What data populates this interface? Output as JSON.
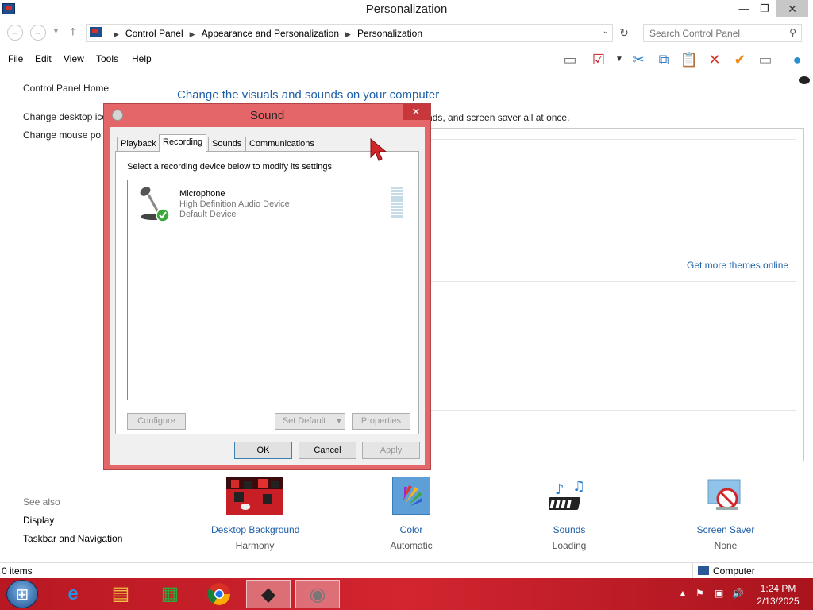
{
  "window": {
    "title": "Personalization",
    "minimize": "—",
    "maximize": "❐",
    "close": "✕"
  },
  "address": {
    "crumbs": [
      "Control Panel",
      "Appearance and Personalization",
      "Personalization"
    ],
    "search_placeholder": "Search Control Panel"
  },
  "menu": [
    "File",
    "Edit",
    "View",
    "Tools",
    "Help"
  ],
  "left_pane": {
    "home": "Control Panel Home",
    "links": [
      "Change desktop ico",
      "Change mouse poi"
    ],
    "see_also": "See also",
    "see_also_links": [
      "Display",
      "Taskbar and Navigation"
    ]
  },
  "main": {
    "title": "Change the visuals and sounds on your computer",
    "subtitle_fragment": "nds, and screen saver all at once.",
    "get_more_themes": "Get more themes online"
  },
  "settings": [
    {
      "label": "Desktop Background",
      "value": "Harmony",
      "icon": "desktop-background-thumbnail"
    },
    {
      "label": "Color",
      "value": "Automatic",
      "icon": "color-swatch-icon"
    },
    {
      "label": "Sounds",
      "value": "Loading",
      "icon": "music-notes-icon"
    },
    {
      "label": "Screen Saver",
      "value": "None",
      "icon": "screen-saver-icon"
    }
  ],
  "status": {
    "items": "0 items",
    "zone": "Computer"
  },
  "taskbar": {
    "time": "1:24 PM",
    "date": "2/13/2025",
    "apps": [
      "internet-explorer-icon",
      "file-explorer-icon",
      "store-icon",
      "chrome-icon",
      "app-icon",
      "sound-app-icon"
    ]
  },
  "dialog": {
    "title": "Sound",
    "tabs": [
      "Playback",
      "Recording",
      "Sounds",
      "Communications"
    ],
    "selected_tab": "Recording",
    "instruction": "Select a recording device below to modify its settings:",
    "device": {
      "name": "Microphone",
      "description": "High Definition Audio Device",
      "status": "Default Device"
    },
    "buttons": {
      "configure": "Configure",
      "set_default": "Set Default",
      "properties": "Properties",
      "ok": "OK",
      "cancel": "Cancel",
      "apply": "Apply"
    }
  },
  "colors": {
    "dialog_frame": "#e56669",
    "link_blue": "#1e5fa8",
    "taskbar_red": "#d22530"
  }
}
